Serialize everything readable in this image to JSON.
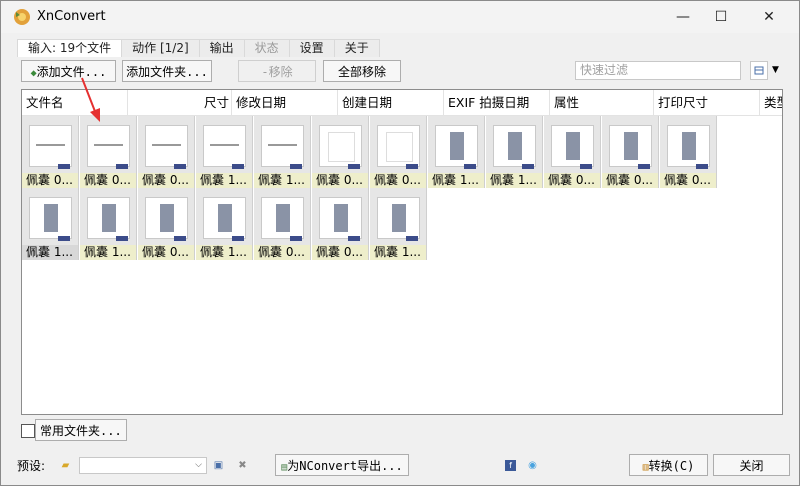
{
  "window": {
    "title": "XnConvert",
    "controls": [
      "—",
      "☐",
      "✕"
    ]
  },
  "tabs": [
    {
      "label": "输入:  19个文件",
      "state": "active"
    },
    {
      "label": "动作 [1/2]",
      "state": "normal"
    },
    {
      "label": "输出",
      "state": "normal"
    },
    {
      "label": "状态",
      "state": "disabled"
    },
    {
      "label": "设置",
      "state": "normal"
    },
    {
      "label": "关于",
      "state": "normal"
    }
  ],
  "toolbar": {
    "add_files": "添加文件...",
    "add_folder": "添加文件夹...",
    "remove": "移除",
    "remove_all": "全部移除",
    "filter_placeholder": "快速过滤"
  },
  "columns": [
    "文件名",
    "尺寸",
    "修改日期",
    "创建日期",
    "EXIF 拍摄日期",
    "属性",
    "打印尺寸",
    "类型"
  ],
  "thumbnails": [
    {
      "label": "佩囊 0..."
    },
    {
      "label": "佩囊 0..."
    },
    {
      "label": "佩囊 0..."
    },
    {
      "label": "佩囊 1..."
    },
    {
      "label": "佩囊 1..."
    },
    {
      "label": "佩囊 0..."
    },
    {
      "label": "佩囊 0..."
    },
    {
      "label": "佩囊 1..."
    },
    {
      "label": "佩囊 1..."
    },
    {
      "label": "佩囊 0..."
    },
    {
      "label": "佩囊 0..."
    },
    {
      "label": "佩囊 0..."
    },
    {
      "label": "佩囊 1..."
    },
    {
      "label": "佩囊 1..."
    },
    {
      "label": "佩囊 0..."
    },
    {
      "label": "佩囊 1..."
    },
    {
      "label": "佩囊 0..."
    },
    {
      "label": "佩囊 0..."
    },
    {
      "label": "佩囊 1..."
    }
  ],
  "footer": {
    "favorites": "常用文件夹...",
    "preset_label": "预设:",
    "export_button": "为NConvert导出...",
    "convert_button": "转换(C)",
    "close_button": "关闭"
  }
}
